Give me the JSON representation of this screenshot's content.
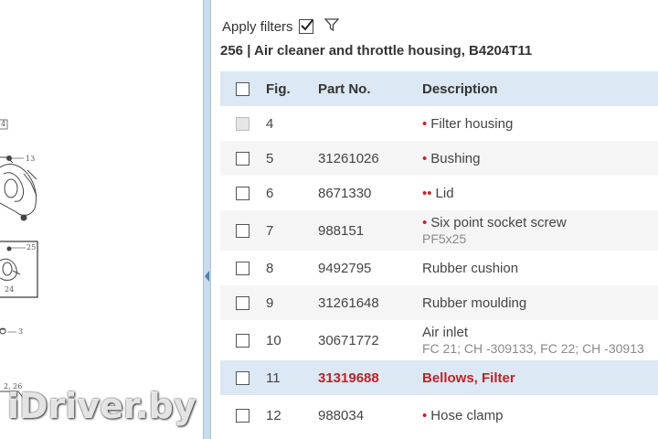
{
  "filters": {
    "label": "Apply filters",
    "checked": true
  },
  "group_title": "256  |  Air cleaner and throttle housing, B4204T11",
  "columns": {
    "fig": "Fig.",
    "part_no": "Part No.",
    "description": "Description"
  },
  "rows": [
    {
      "fig": "4",
      "part_no": "",
      "bullet": "•",
      "description": "Filter housing",
      "sub": ""
    },
    {
      "fig": "5",
      "part_no": "31261026",
      "bullet": "•",
      "description": "Bushing",
      "sub": ""
    },
    {
      "fig": "6",
      "part_no": "8671330",
      "bullet": "••",
      "description": "Lid",
      "sub": ""
    },
    {
      "fig": "7",
      "part_no": "988151",
      "bullet": "•",
      "description": "Six point socket screw",
      "sub": "PF5x25"
    },
    {
      "fig": "8",
      "part_no": "9492795",
      "bullet": "",
      "description": "Rubber cushion",
      "sub": ""
    },
    {
      "fig": "9",
      "part_no": "31261648",
      "bullet": "",
      "description": "Rubber moulding",
      "sub": ""
    },
    {
      "fig": "10",
      "part_no": "30671772",
      "bullet": "",
      "description": "Air inlet",
      "sub": "FC 21; CH -309133, FC 22; CH -30913"
    },
    {
      "fig": "11",
      "part_no": "31319688",
      "bullet": "",
      "description": "Bellows, Filter",
      "sub": ""
    },
    {
      "fig": "12",
      "part_no": "988034",
      "bullet": "•",
      "description": "Hose clamp",
      "sub": ""
    }
  ],
  "diagram": {
    "labels": [
      "4",
      "13",
      "25",
      "24",
      "3",
      "2, 26"
    ]
  },
  "watermark": "iDriver.by",
  "colors": {
    "header_bg": "#dce8f3",
    "selected_text": "#b8252c",
    "bullet": "#c8232c",
    "splitter": "#c9dcea"
  }
}
